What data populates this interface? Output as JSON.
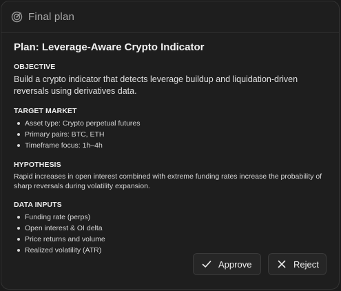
{
  "header": {
    "title": "Final plan",
    "icon": "target-icon"
  },
  "plan": {
    "title": "Plan: Leverage-Aware Crypto Indicator"
  },
  "objective": {
    "heading": "OBJECTIVE",
    "text": "Build a crypto indicator that detects leverage buildup and liquidation-driven reversals using derivatives data."
  },
  "target_market": {
    "heading": "TARGET MARKET",
    "items": [
      "Asset type: Crypto perpetual futures",
      "Primary pairs: BTC, ETH",
      "Timeframe focus: 1h–4h"
    ]
  },
  "hypothesis": {
    "heading": "HYPOTHESIS",
    "text": "Rapid increases in open interest combined with extreme funding rates increase the probability of sharp reversals during volatility expansion."
  },
  "data_inputs": {
    "heading": "DATA INPUTS",
    "items": [
      "Funding rate (perps)",
      "Open interest & OI delta",
      "Price returns and volume",
      "Realized volatility (ATR)"
    ]
  },
  "actions": {
    "approve_label": "Approve",
    "approve_icon": "check-icon",
    "reject_label": "Reject",
    "reject_icon": "x-icon"
  },
  "colors": {
    "background": "#1e1e1e",
    "text": "#e6e6e6",
    "muted": "#a9a9a9",
    "button": "#262626"
  }
}
